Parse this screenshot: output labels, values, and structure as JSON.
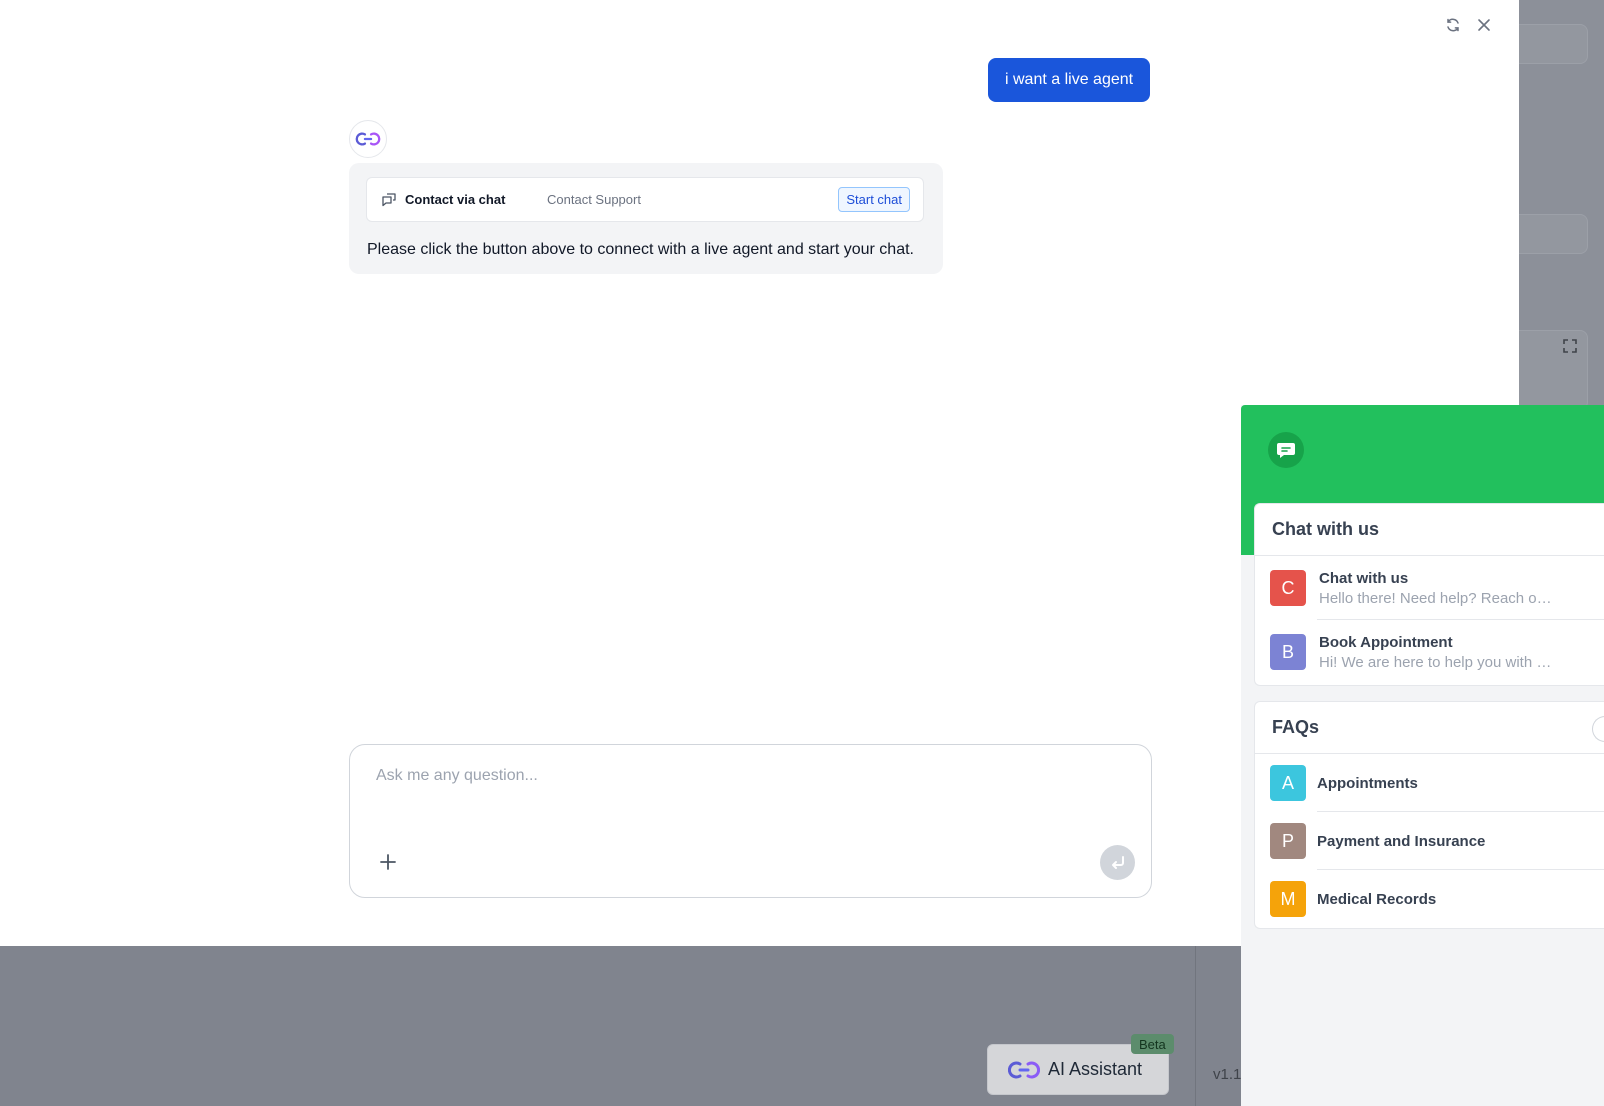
{
  "background": {
    "version_text": "v1.1.",
    "ai_assistant": {
      "label": "AI Assistant",
      "beta": "Beta"
    }
  },
  "chat": {
    "user_message": "i want a live agent",
    "bot": {
      "contact_card": {
        "title": "Contact via chat",
        "subtitle": "Contact Support",
        "button": "Start chat"
      },
      "message": "Please click the button above to connect with a live agent and start your chat."
    },
    "composer": {
      "placeholder": "Ask me any question..."
    }
  },
  "widget": {
    "chat_section": {
      "title": "Chat with us",
      "items": [
        {
          "letter": "C",
          "title": "Chat with us",
          "subtitle": "Hello there! Need help? Reach out to us right here",
          "color": "#e5534b"
        },
        {
          "letter": "B",
          "title": "Book Appointment",
          "subtitle": "Hi! We are here to help you with appointments",
          "color": "#7c83d4"
        }
      ]
    },
    "faq_section": {
      "title": "FAQs",
      "items": [
        {
          "letter": "A",
          "title": "Appointments",
          "color": "#3cc6de"
        },
        {
          "letter": "P",
          "title": "Payment and Insurance",
          "color": "#a1887f"
        },
        {
          "letter": "M",
          "title": "Medical Records",
          "color": "#f5a30a"
        }
      ]
    }
  },
  "icons": {
    "refresh": "refresh-icon",
    "close": "close-icon",
    "chat_bubble": "chat-bubble-icon",
    "plus": "plus-icon",
    "send": "enter-arrow-icon",
    "expand": "expand-icon"
  }
}
